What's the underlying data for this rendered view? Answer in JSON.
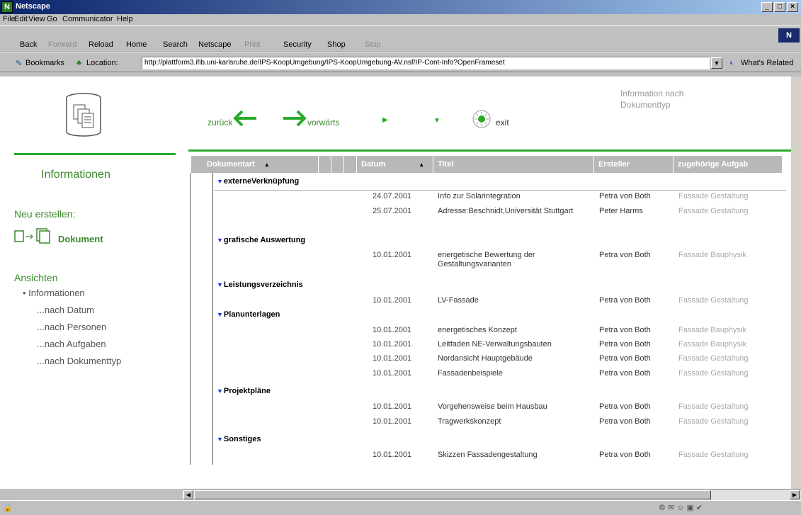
{
  "window": {
    "title": "Netscape"
  },
  "menu": [
    "File",
    "Edit",
    "View",
    "Go",
    "Communicator",
    "Help"
  ],
  "toolbar": {
    "back": "Back",
    "forward": "Forward",
    "reload": "Reload",
    "home": "Home",
    "search": "Search",
    "netscape": "Netscape",
    "print": "Print",
    "security": "Security",
    "shop": "Shop",
    "stop": "Stop"
  },
  "location": {
    "bookmarks": "Bookmarks",
    "label": "Location:",
    "url": "http://plattform3.ifib.uni-karlsruhe.de/IPS-KoopUmgebung/IPS-KoopUmgebung-AV.nsf/IP-Cont-Info?OpenFrameset",
    "related": "What's Related"
  },
  "top_nav": {
    "back": "zurück",
    "forward": "vorwärts",
    "exit": "exit",
    "info_title": "Information nach Dokumenttyp"
  },
  "sidebar": {
    "informationen": "Informationen",
    "neu_erstellen": "Neu erstellen:",
    "dokument": "Dokument",
    "ansichten": "Ansichten",
    "views": [
      "• Informationen",
      "...nach Datum",
      "...nach Personen",
      "...nach Aufgaben",
      "...nach Dokumenttyp"
    ]
  },
  "table": {
    "headers": [
      "Dokumentart",
      "Datum",
      "Titel",
      "Ersteller",
      "zugehörige Aufgab"
    ],
    "groups": [
      {
        "name": "externeVerknüpfung",
        "rows": [
          {
            "date": "24.07.2001",
            "title": "Info zur Solarintegration",
            "author": "Petra von Both",
            "task": "Fassade Gestaltung"
          },
          {
            "date": "25.07.2001",
            "title": "Adresse:Beschnidt,Universität Stuttgart",
            "author": "Peter Harms",
            "task": "Fassade Gestaltung"
          }
        ]
      },
      {
        "name": "grafische Auswertung",
        "rows": [
          {
            "date": "10.01.2001",
            "title": "energetische Bewertung der Gestaltungsvarianten",
            "author": "Petra von Both",
            "task": "Fassade Bauphysik"
          }
        ]
      },
      {
        "name": "Leistungsverzeichnis",
        "rows": [
          {
            "date": "10.01.2001",
            "title": "LV-Fassade",
            "author": "Petra von Both",
            "task": "Fassade Gestaltung"
          }
        ]
      },
      {
        "name": "Planunterlagen",
        "rows": [
          {
            "date": "10.01.2001",
            "title": "energetisches Konzept",
            "author": "Petra von Both",
            "task": "Fassade Bauphysik"
          },
          {
            "date": "10.01.2001",
            "title": "Leitfaden NE-Verwaltungsbauten",
            "author": "Petra von Both",
            "task": "Fassade Bauphysik"
          },
          {
            "date": "10.01.2001",
            "title": "Nordansicht Hauptgebäude",
            "author": "Petra von Both",
            "task": "Fassade Gestaltung"
          },
          {
            "date": "10.01.2001",
            "title": "Fassadenbeispiele",
            "author": "Petra von Both",
            "task": "Fassade Gestaltung"
          }
        ]
      },
      {
        "name": "Projektpläne",
        "rows": [
          {
            "date": "10.01.2001",
            "title": "Vorgehensweise beim Hausbau",
            "author": "Petra von Both",
            "task": "Fassade Gestaltung"
          },
          {
            "date": "10.01.2001",
            "title": "Tragwerkskonzept",
            "author": "Petra von Both",
            "task": "Fassade Gestaltung"
          }
        ]
      },
      {
        "name": "Sonstiges",
        "rows": [
          {
            "date": "10.01.2001",
            "title": "Skizzen Fassadengestaltung",
            "author": "Petra von Both",
            "task": "Fassade Gestaltung"
          }
        ]
      }
    ]
  },
  "colors": {
    "accent_green": "#2aaa2a",
    "link_green": "#3a8a2a",
    "header_gray": "#b8b8b8",
    "triangle_blue": "#1a2aff"
  }
}
